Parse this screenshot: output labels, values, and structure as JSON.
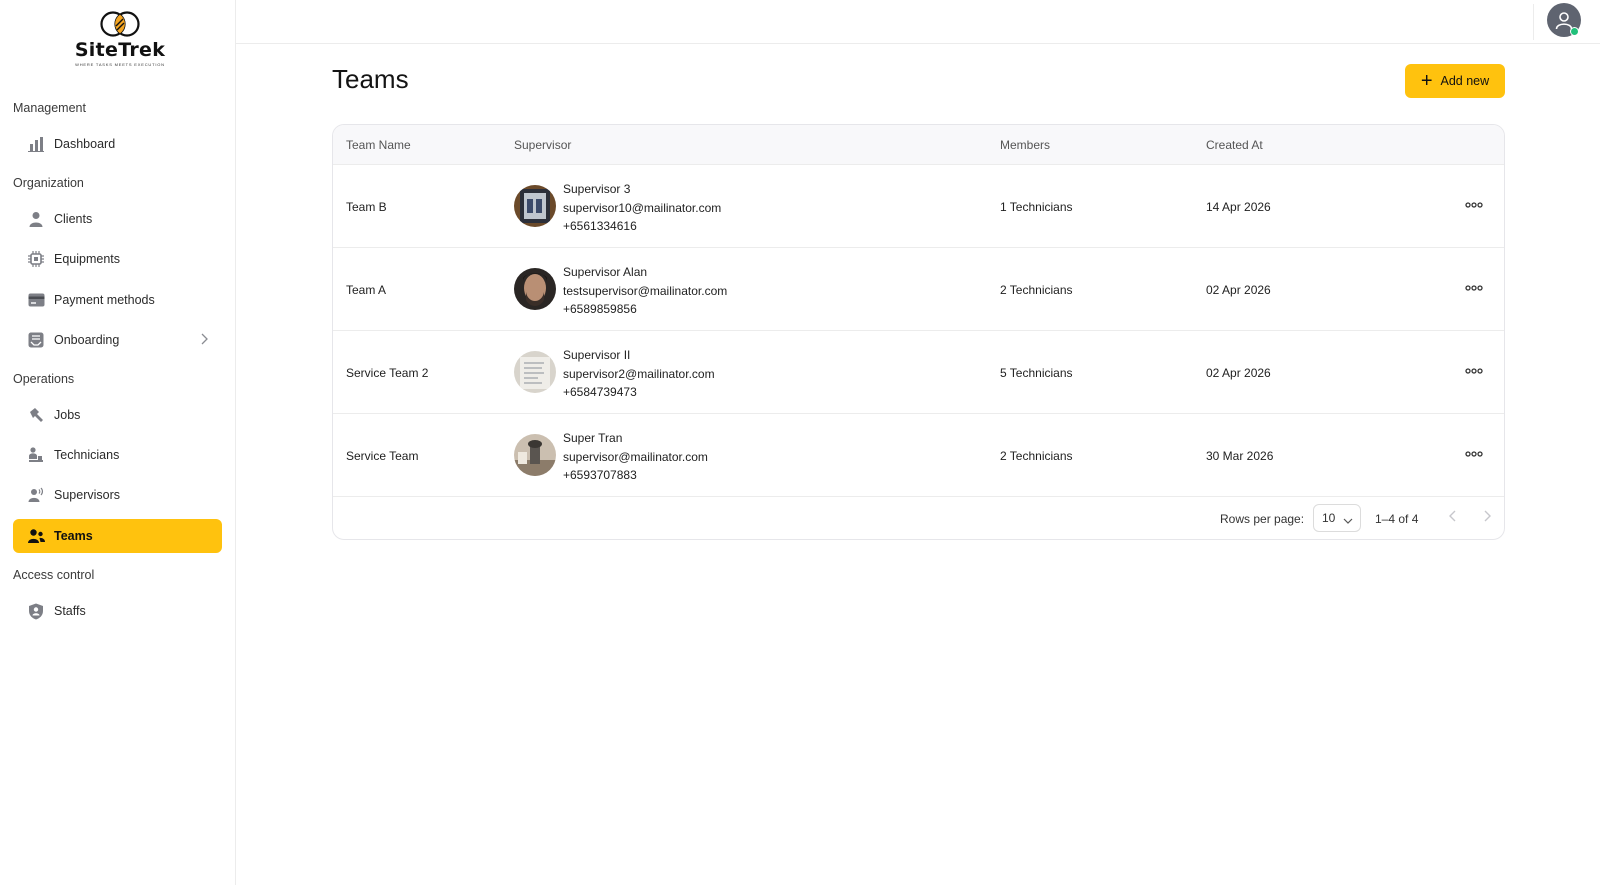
{
  "brand": {
    "name": "SiteTrek",
    "tagline": "WHERE TASKS MEETS EXECUTION"
  },
  "sidebar": {
    "sections": [
      {
        "title": "Management",
        "items": [
          {
            "label": "Dashboard",
            "icon": "bar-chart-icon"
          }
        ]
      },
      {
        "title": "Organization",
        "items": [
          {
            "label": "Clients",
            "icon": "person-icon"
          },
          {
            "label": "Equipments",
            "icon": "chip-icon"
          },
          {
            "label": "Payment methods",
            "icon": "card-icon"
          },
          {
            "label": "Onboarding",
            "icon": "inbox-icon"
          }
        ]
      },
      {
        "title": "Operations",
        "items": [
          {
            "label": "Jobs",
            "icon": "hammer-icon"
          },
          {
            "label": "Technicians",
            "icon": "technician-icon"
          },
          {
            "label": "Supervisors",
            "icon": "supervisor-icon"
          },
          {
            "label": "Teams",
            "icon": "team-icon",
            "active": true
          }
        ]
      },
      {
        "title": "Access control",
        "items": [
          {
            "label": "Staffs",
            "icon": "shield-user-icon"
          }
        ]
      }
    ]
  },
  "page": {
    "title": "Teams",
    "add_label": "Add new",
    "accent": "#FFC20E"
  },
  "table": {
    "columns": [
      "Team Name",
      "Supervisor",
      "Members",
      "Created At"
    ],
    "rows": [
      {
        "team": "Team B",
        "supervisor_name": "Supervisor 3",
        "email": "supervisor10@mailinator.com",
        "phone": "+6561334616",
        "members": "1 Technicians",
        "created": "14 Apr 2026"
      },
      {
        "team": "Team A",
        "supervisor_name": "Supervisor Alan",
        "email": "testsupervisor@mailinator.com",
        "phone": "+6589859856",
        "members": "2 Technicians",
        "created": "02 Apr 2026"
      },
      {
        "team": "Service Team 2",
        "supervisor_name": "Supervisor II",
        "email": "supervisor2@mailinator.com",
        "phone": "+6584739473",
        "members": "5 Technicians",
        "created": "02 Apr 2026"
      },
      {
        "team": "Service Team",
        "supervisor_name": "Super Tran",
        "email": "supervisor@mailinator.com",
        "phone": "+6593707883",
        "members": "2 Technicians",
        "created": "30 Mar 2026"
      }
    ]
  },
  "pagination": {
    "rows_per_page_label": "Rows per page:",
    "rows_per_page": "10",
    "range": "1–4 of 4"
  },
  "status_colors": {
    "online": "#21c07a"
  }
}
